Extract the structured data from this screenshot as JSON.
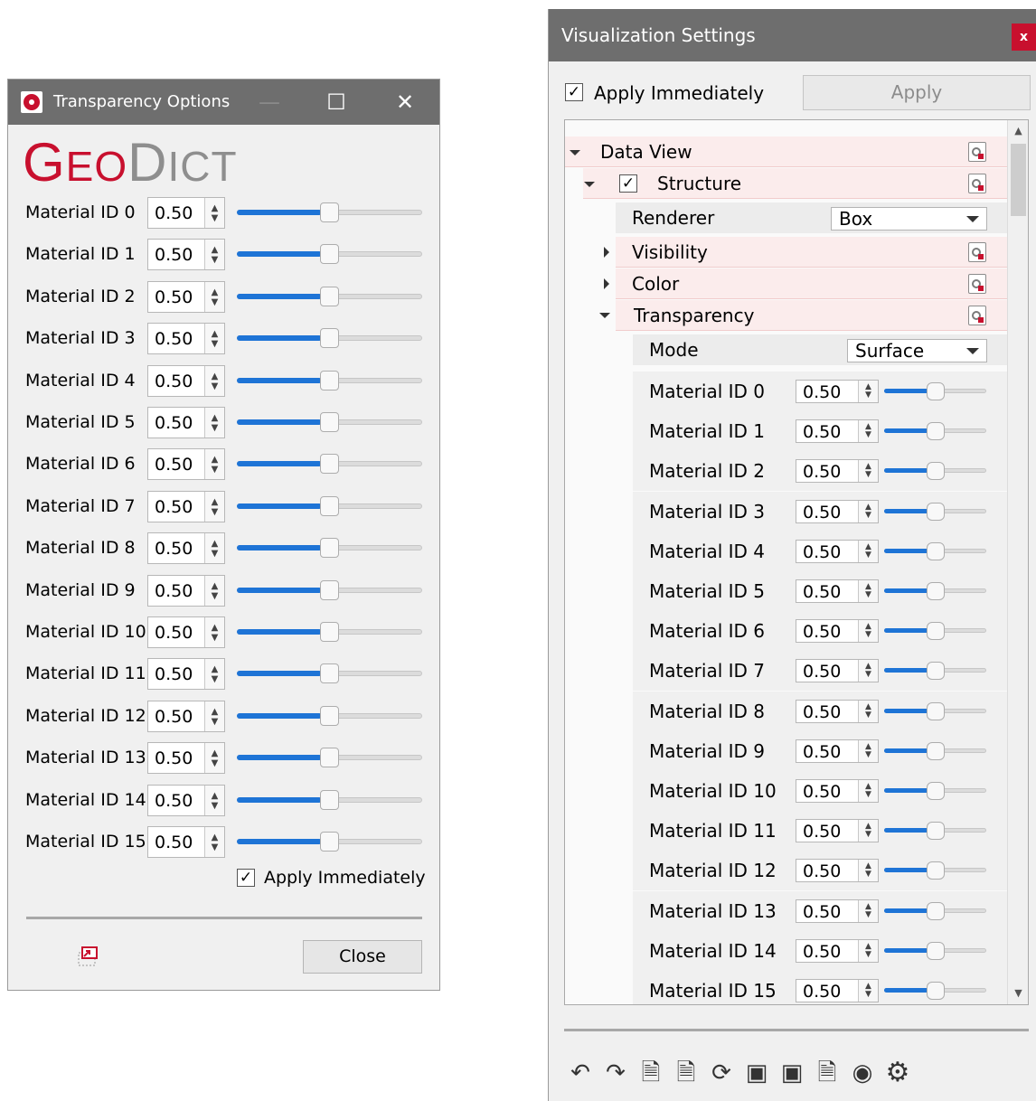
{
  "left_window": {
    "title": "Transparency Options",
    "logo": {
      "part1_cap": "G",
      "part1_rest": "EO",
      "part2_cap": "D",
      "part2_rest": "ICT"
    },
    "materials": [
      {
        "label": "Material ID 0",
        "value": "0.50",
        "level": 0.5
      },
      {
        "label": "Material ID 1",
        "value": "0.50",
        "level": 0.5
      },
      {
        "label": "Material ID 2",
        "value": "0.50",
        "level": 0.5
      },
      {
        "label": "Material ID 3",
        "value": "0.50",
        "level": 0.5
      },
      {
        "label": "Material ID 4",
        "value": "0.50",
        "level": 0.5
      },
      {
        "label": "Material ID 5",
        "value": "0.50",
        "level": 0.5
      },
      {
        "label": "Material ID 6",
        "value": "0.50",
        "level": 0.5
      },
      {
        "label": "Material ID 7",
        "value": "0.50",
        "level": 0.5
      },
      {
        "label": "Material ID 8",
        "value": "0.50",
        "level": 0.5
      },
      {
        "label": "Material ID 9",
        "value": "0.50",
        "level": 0.5
      },
      {
        "label": "Material ID 10",
        "value": "0.50",
        "level": 0.5
      },
      {
        "label": "Material ID 11",
        "value": "0.50",
        "level": 0.5
      },
      {
        "label": "Material ID 12",
        "value": "0.50",
        "level": 0.5
      },
      {
        "label": "Material ID 13",
        "value": "0.50",
        "level": 0.5
      },
      {
        "label": "Material ID 14",
        "value": "0.50",
        "level": 0.5
      },
      {
        "label": "Material ID 15",
        "value": "0.50",
        "level": 0.5
      }
    ],
    "apply_immediately": {
      "label": "Apply Immediately",
      "checked": true
    },
    "close_label": "Close"
  },
  "right_window": {
    "title": "Visualization Settings",
    "close_glyph": "x",
    "apply_immediately": {
      "label": "Apply Immediately",
      "checked": true
    },
    "apply_label": "Apply",
    "tree": {
      "data_view": "Data View",
      "structure": "Structure",
      "renderer_label": "Renderer",
      "renderer_value": "Box",
      "visibility": "Visibility",
      "color": "Color",
      "transparency": "Transparency",
      "mode_label": "Mode",
      "mode_value": "Surface"
    },
    "materials": [
      {
        "label": "Material ID 0",
        "value": "0.50",
        "level": 0.5
      },
      {
        "label": "Material ID 1",
        "value": "0.50",
        "level": 0.5
      },
      {
        "label": "Material ID 2",
        "value": "0.50",
        "level": 0.5
      },
      {
        "label": "Material ID 3",
        "value": "0.50",
        "level": 0.5
      },
      {
        "label": "Material ID 4",
        "value": "0.50",
        "level": 0.5
      },
      {
        "label": "Material ID 5",
        "value": "0.50",
        "level": 0.5
      },
      {
        "label": "Material ID 6",
        "value": "0.50",
        "level": 0.5
      },
      {
        "label": "Material ID 7",
        "value": "0.50",
        "level": 0.5
      },
      {
        "label": "Material ID 8",
        "value": "0.50",
        "level": 0.5
      },
      {
        "label": "Material ID 9",
        "value": "0.50",
        "level": 0.5
      },
      {
        "label": "Material ID 10",
        "value": "0.50",
        "level": 0.5
      },
      {
        "label": "Material ID 11",
        "value": "0.50",
        "level": 0.5
      },
      {
        "label": "Material ID 12",
        "value": "0.50",
        "level": 0.5
      },
      {
        "label": "Material ID 13",
        "value": "0.50",
        "level": 0.5
      },
      {
        "label": "Material ID 14",
        "value": "0.50",
        "level": 0.5
      },
      {
        "label": "Material ID 15",
        "value": "0.50",
        "level": 0.5
      }
    ],
    "toolbar_icons": [
      "undo-icon",
      "redo-icon",
      "load-settings-icon",
      "save-settings-icon",
      "refresh-settings-icon",
      "render-settings-icon",
      "load-render-icon",
      "code-export-icon",
      "eye-icon",
      "gear-icon"
    ]
  },
  "colors": {
    "accent": "#1e74d6",
    "brand_red": "#c8102e",
    "titlebar": "#6e6e6e",
    "highlight_row": "#fbecec"
  }
}
